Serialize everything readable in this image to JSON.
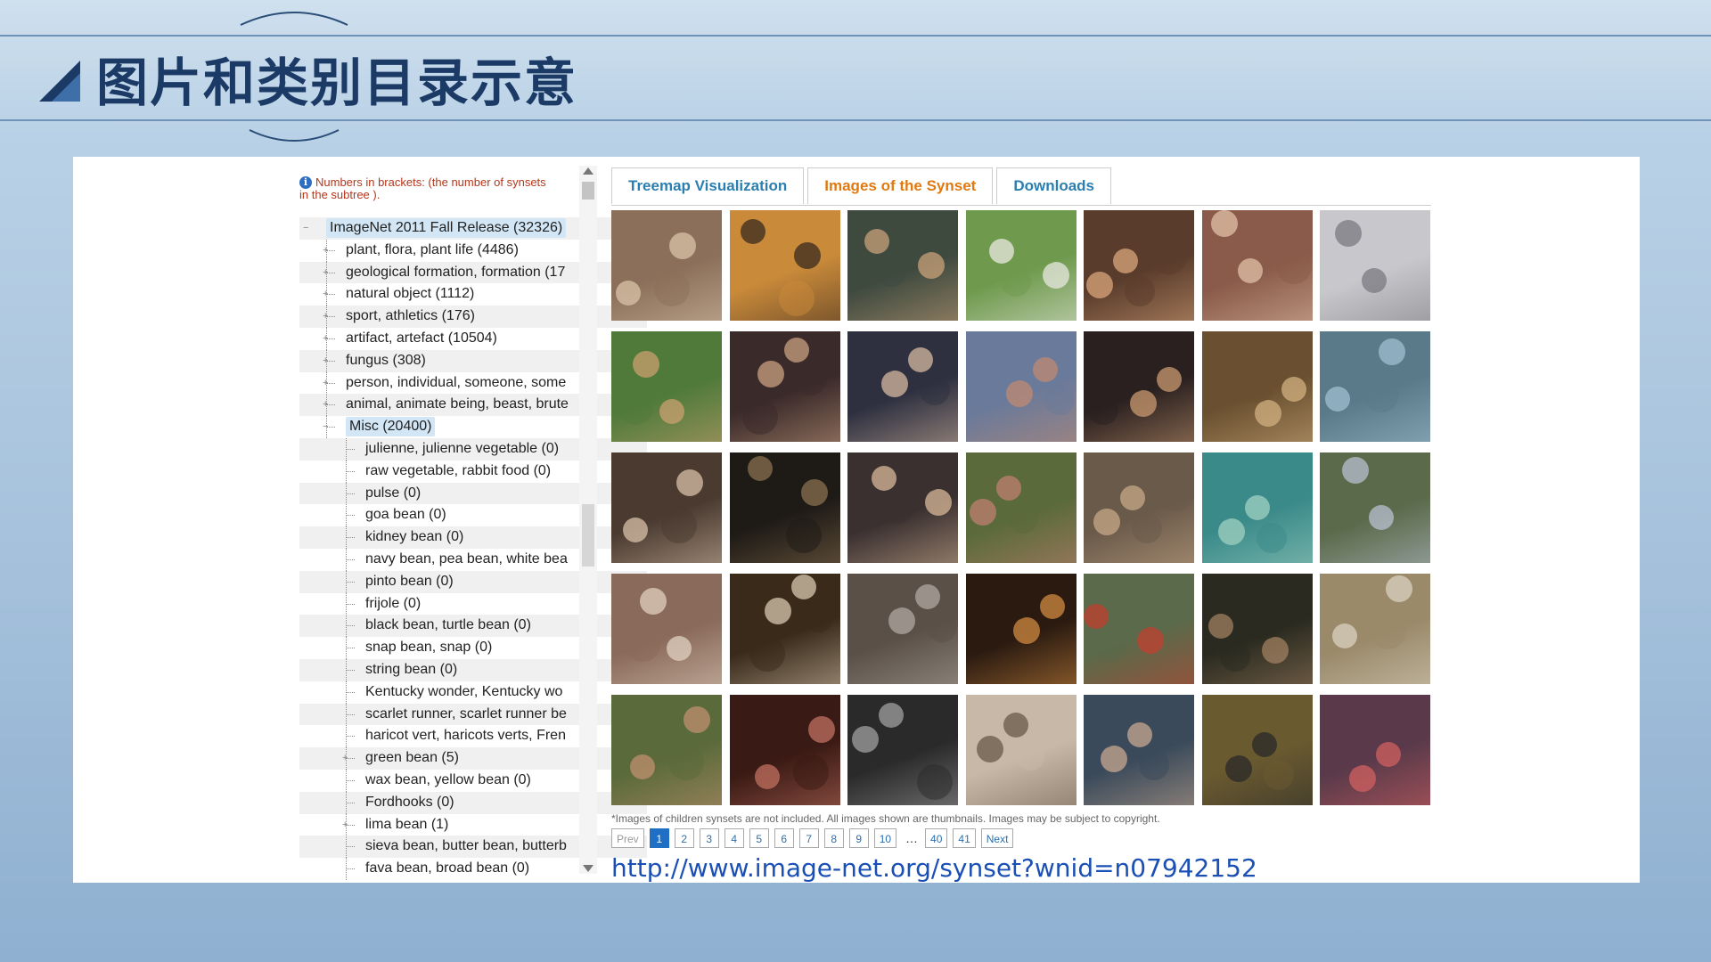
{
  "slide": {
    "title": "图片和类别目录示意"
  },
  "tree": {
    "info": "Numbers in brackets: (the number of synsets in the subtree ).",
    "items": [
      {
        "label": "ImageNet 2011 Fall Release (32326)",
        "level": 0,
        "selected": true,
        "expander": "minus"
      },
      {
        "label": "plant, flora, plant life (4486)",
        "level": 1,
        "expander": "plus"
      },
      {
        "label": "geological formation, formation (17",
        "level": 1,
        "expander": "plus"
      },
      {
        "label": "natural object (1112)",
        "level": 1,
        "expander": "plus"
      },
      {
        "label": "sport, athletics (176)",
        "level": 1,
        "expander": "plus"
      },
      {
        "label": "artifact, artefact (10504)",
        "level": 1,
        "expander": "plus"
      },
      {
        "label": "fungus (308)",
        "level": 1,
        "expander": "plus"
      },
      {
        "label": "person, individual, someone, some",
        "level": 1,
        "expander": "plus"
      },
      {
        "label": "animal, animate being, beast, brute",
        "level": 1,
        "expander": "plus"
      },
      {
        "label": "Misc (20400)",
        "level": 1,
        "selected": true,
        "expander": "minus"
      },
      {
        "label": "julienne, julienne vegetable (0)",
        "level": 2
      },
      {
        "label": "raw vegetable, rabbit food (0)",
        "level": 2
      },
      {
        "label": "pulse (0)",
        "level": 2
      },
      {
        "label": "goa bean (0)",
        "level": 2
      },
      {
        "label": "kidney bean (0)",
        "level": 2
      },
      {
        "label": "navy bean, pea bean, white bea",
        "level": 2
      },
      {
        "label": "pinto bean (0)",
        "level": 2
      },
      {
        "label": "frijole (0)",
        "level": 2
      },
      {
        "label": "black bean, turtle bean (0)",
        "level": 2
      },
      {
        "label": "snap bean, snap (0)",
        "level": 2
      },
      {
        "label": "string bean (0)",
        "level": 2
      },
      {
        "label": "Kentucky wonder, Kentucky wo",
        "level": 2
      },
      {
        "label": "scarlet runner, scarlet runner be",
        "level": 2
      },
      {
        "label": "haricot vert, haricots verts, Fren",
        "level": 2
      },
      {
        "label": "green bean (5)",
        "level": 2,
        "expander": "plus"
      },
      {
        "label": "wax bean, yellow bean (0)",
        "level": 2
      },
      {
        "label": "Fordhooks (0)",
        "level": 2
      },
      {
        "label": "lima bean (1)",
        "level": 2,
        "expander": "plus"
      },
      {
        "label": "sieva bean, butter bean, butterb",
        "level": 2
      },
      {
        "label": "fava bean, broad bean (0)",
        "level": 2
      }
    ]
  },
  "tabs": [
    {
      "label": "Treemap Visualization"
    },
    {
      "label": "Images of the Synset"
    },
    {
      "label": "Downloads"
    }
  ],
  "thumbnails": [
    {
      "bg": "#8b6f5a",
      "fg": "#d8c3a8"
    },
    {
      "bg": "#c98a3a",
      "fg": "#3a2a20"
    },
    {
      "bg": "#3f4a3f",
      "fg": "#c9a27a"
    },
    {
      "bg": "#6f9a4e",
      "fg": "#e8e8e0"
    },
    {
      "bg": "#5a3c2c",
      "fg": "#d9a57a"
    },
    {
      "bg": "#8a5b4a",
      "fg": "#e0c0a8"
    },
    {
      "bg": "#c8c8cc",
      "fg": "#7a7a80"
    },
    {
      "bg": "#4f7a3a",
      "fg": "#c9a070"
    },
    {
      "bg": "#3a2a2a",
      "fg": "#caa080"
    },
    {
      "bg": "#2e3040",
      "fg": "#d6b8a0"
    },
    {
      "bg": "#6a7a9a",
      "fg": "#c08a70"
    },
    {
      "bg": "#2a2020",
      "fg": "#c99a70"
    },
    {
      "bg": "#6a5030",
      "fg": "#d2b080"
    },
    {
      "bg": "#5a7a8a",
      "fg": "#a0c0d0"
    },
    {
      "bg": "#4a3a30",
      "fg": "#d8c0a8"
    },
    {
      "bg": "#1e1a16",
      "fg": "#8a7050"
    },
    {
      "bg": "#3a3030",
      "fg": "#d8b898"
    },
    {
      "bg": "#5a6a3a",
      "fg": "#c08070"
    },
    {
      "bg": "#6a5a4a",
      "fg": "#c8a888"
    },
    {
      "bg": "#3a8a8a",
      "fg": "#a0d0c0"
    },
    {
      "bg": "#5a6a4a",
      "fg": "#b8c0d0"
    },
    {
      "bg": "#8a6a5a",
      "fg": "#e0d0c0"
    },
    {
      "bg": "#3a2a1a",
      "fg": "#d8c8b0"
    },
    {
      "bg": "#5a5048",
      "fg": "#b0a8a0"
    },
    {
      "bg": "#2a1a10",
      "fg": "#d08a40"
    },
    {
      "bg": "#5a6a4a",
      "fg": "#c04030"
    },
    {
      "bg": "#2a2a20",
      "fg": "#a08060"
    },
    {
      "bg": "#9a8a6a",
      "fg": "#d8d0c0"
    },
    {
      "bg": "#5a6a3a",
      "fg": "#c09070"
    },
    {
      "bg": "#3a1a14",
      "fg": "#c07060"
    },
    {
      "bg": "#2a2a2a",
      "fg": "#a0a0a0"
    },
    {
      "bg": "#c8b8a8",
      "fg": "#6a5a4a"
    },
    {
      "bg": "#3a4a5a",
      "fg": "#c8a890"
    },
    {
      "bg": "#6a5a30",
      "fg": "#2a2a2a"
    },
    {
      "bg": "#5a3a4a",
      "fg": "#d06060"
    }
  ],
  "note": "*Images of children synsets are not included. All images shown are thumbnails. Images may be subject to copyright.",
  "pager": {
    "prev": "Prev",
    "pages": [
      "1",
      "2",
      "3",
      "4",
      "5",
      "6",
      "7",
      "8",
      "9",
      "10"
    ],
    "current": "1",
    "gap": "…",
    "tail": [
      "40",
      "41"
    ],
    "next": "Next"
  },
  "url": "http://www.image-net.org/synset?wnid=n07942152"
}
